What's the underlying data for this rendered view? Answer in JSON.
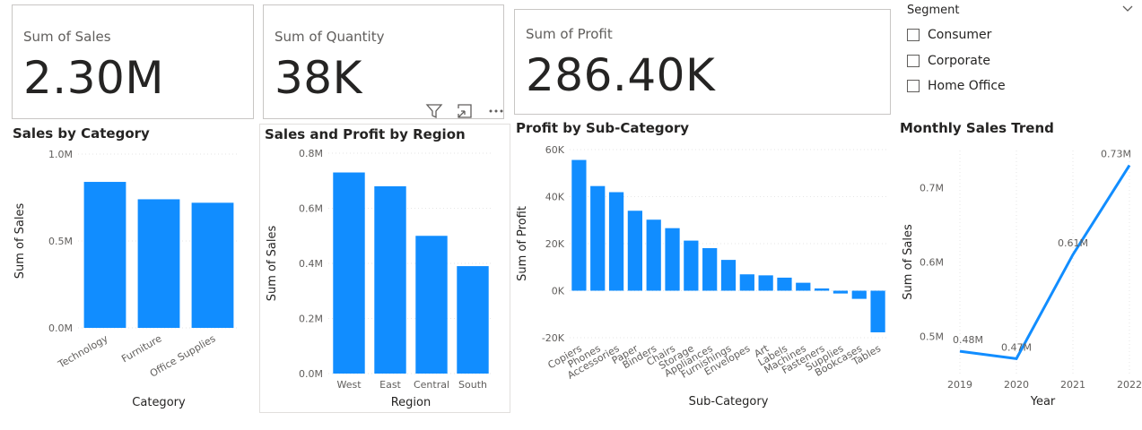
{
  "cards": [
    {
      "label": "Sum of Sales",
      "value": "2.30M"
    },
    {
      "label": "Sum of Quantity",
      "value": "38K"
    },
    {
      "label": "Sum of Profit",
      "value": "286.40K"
    }
  ],
  "slicer": {
    "title": "Segment",
    "items": [
      "Consumer",
      "Corporate",
      "Home Office"
    ]
  },
  "visual_header": {
    "icons": [
      "filter-icon",
      "focus-mode-icon",
      "more-options-icon"
    ]
  },
  "theme": {
    "bar_color": "#118DFF",
    "line_color": "#118DFF"
  },
  "chart_data": [
    {
      "type": "bar",
      "title": "Sales by Category",
      "xlabel": "Category",
      "ylabel": "Sum of Sales",
      "categories": [
        "Technology",
        "Furniture",
        "Office Supplies"
      ],
      "values": [
        0.84,
        0.74,
        0.72
      ],
      "ylim": [
        0,
        1.0
      ],
      "yticks": [
        0,
        0.5,
        1.0
      ],
      "ytick_labels": [
        "0.0M",
        "0.5M",
        "1.0M"
      ]
    },
    {
      "type": "bar",
      "title": "Sales and Profit by Region",
      "xlabel": "Region",
      "ylabel": "Sum of Sales",
      "categories": [
        "West",
        "East",
        "Central",
        "South"
      ],
      "values": [
        0.73,
        0.68,
        0.5,
        0.39
      ],
      "ylim": [
        0,
        0.8
      ],
      "yticks": [
        0,
        0.2,
        0.4,
        0.6,
        0.8
      ],
      "ytick_labels": [
        "0.0M",
        "0.2M",
        "0.4M",
        "0.6M",
        "0.8M"
      ]
    },
    {
      "type": "bar",
      "title": "Profit by Sub-Category",
      "xlabel": "Sub-Category",
      "ylabel": "Sum of Profit",
      "categories": [
        "Copiers",
        "Phones",
        "Accessories",
        "Paper",
        "Binders",
        "Chairs",
        "Storage",
        "Appliances",
        "Furnishings",
        "Envelopes",
        "Art",
        "Labels",
        "Machines",
        "Fasteners",
        "Supplies",
        "Bookcases",
        "Tables"
      ],
      "values": [
        55600,
        44500,
        41900,
        34000,
        30200,
        26600,
        21300,
        18100,
        13100,
        6960,
        6530,
        5550,
        3380,
        950,
        -1190,
        -3470,
        -17700
      ],
      "ylim": [
        -20000,
        60000
      ],
      "yticks": [
        -20000,
        0,
        20000,
        40000,
        60000
      ],
      "ytick_labels": [
        "-20K",
        "0K",
        "20K",
        "40K",
        "60K"
      ]
    },
    {
      "type": "line",
      "title": "Monthly Sales Trend",
      "xlabel": "Year",
      "ylabel": "Sum of Sales",
      "x": [
        "2019",
        "2020",
        "2021",
        "2022"
      ],
      "values": [
        0.48,
        0.47,
        0.61,
        0.73
      ],
      "data_labels": [
        "0.48M",
        "0.47M",
        "0.61M",
        "0.73M"
      ],
      "ylim": [
        0.45,
        0.75
      ],
      "yticks": [
        0.5,
        0.6,
        0.7
      ],
      "ytick_labels": [
        "0.5M",
        "0.6M",
        "0.7M"
      ]
    }
  ]
}
